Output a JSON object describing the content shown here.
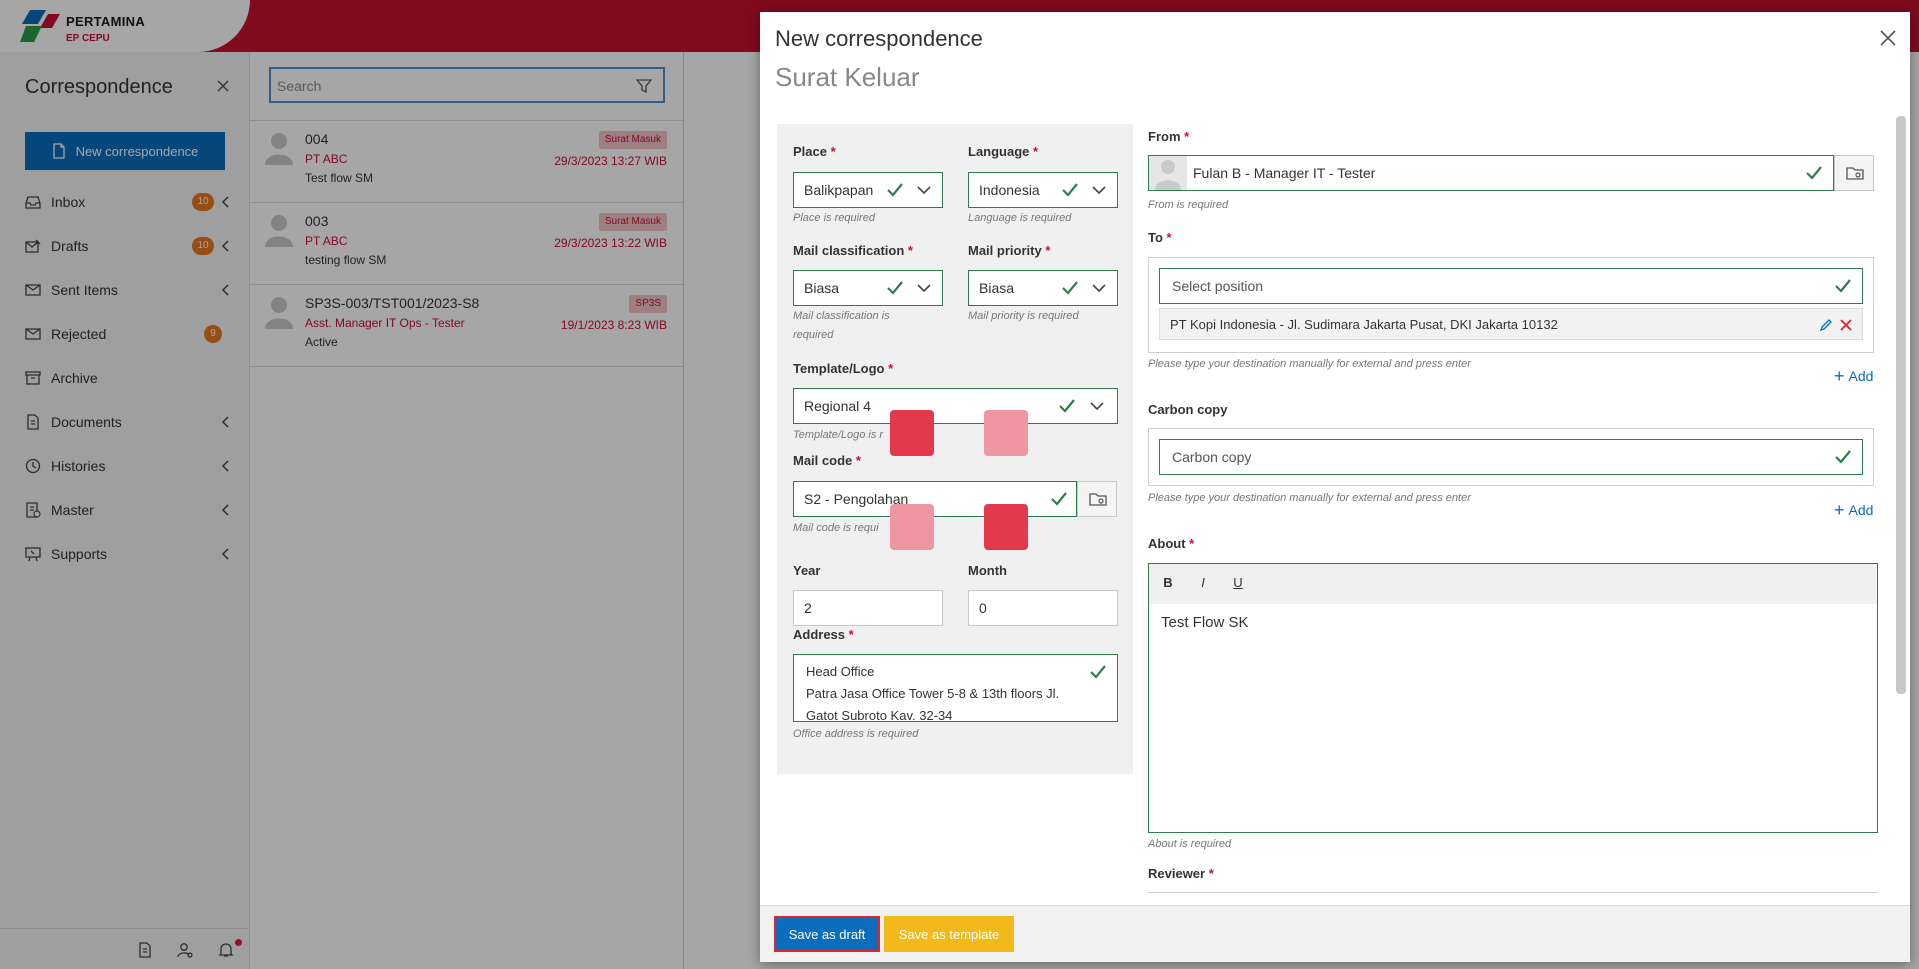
{
  "brand": {
    "name": "PERTAMINA",
    "sub": "EP CEPU"
  },
  "sidebar": {
    "title": "Correspondence",
    "new_button": "New correspondence",
    "items": [
      {
        "label": "Inbox",
        "icon": "inbox-icon",
        "badge": "10",
        "chevron": true
      },
      {
        "label": "Drafts",
        "icon": "drafts-icon",
        "badge": "10",
        "chevron": true
      },
      {
        "label": "Sent Items",
        "icon": "sent-icon",
        "badge": "",
        "chevron": true
      },
      {
        "label": "Rejected",
        "icon": "rejected-icon",
        "badge": "9",
        "chevron": false
      },
      {
        "label": "Archive",
        "icon": "archive-icon",
        "badge": "",
        "chevron": false
      },
      {
        "label": "Documents",
        "icon": "documents-icon",
        "badge": "",
        "chevron": true
      },
      {
        "label": "Histories",
        "icon": "history-icon",
        "badge": "",
        "chevron": true
      },
      {
        "label": "Master",
        "icon": "master-icon",
        "badge": "",
        "chevron": true
      },
      {
        "label": "Supports",
        "icon": "supports-icon",
        "badge": "",
        "chevron": true
      }
    ]
  },
  "list": {
    "search_placeholder": "Search",
    "rows": [
      {
        "number": "004",
        "sender": "PT ABC",
        "subject": "Test flow SM",
        "tag": "Surat Masuk",
        "date": "29/3/2023 13:27 WIB"
      },
      {
        "number": "003",
        "sender": "PT ABC",
        "subject": "testing flow SM",
        "tag": "Surat Masuk",
        "date": "29/3/2023 13:22 WIB"
      },
      {
        "number": "SP3S-003/TST001/2023-S8",
        "sender": "Asst. Manager IT Ops - Tester",
        "subject": "Active",
        "tag": "SP3S",
        "date": "19/1/2023 8:23 WIB"
      }
    ]
  },
  "modal": {
    "title": "New correspondence",
    "subtitle": "Surat Keluar",
    "place": {
      "label": "Place",
      "value": "Balikpapan",
      "hint": "Place is required"
    },
    "language": {
      "label": "Language",
      "value": "Indonesia",
      "hint": "Language is required"
    },
    "classification": {
      "label": "Mail classification",
      "value": "Biasa",
      "hint_line1": "Mail classification is",
      "hint_line2": "required"
    },
    "priority": {
      "label": "Mail priority",
      "value": "Biasa",
      "hint": "Mail priority is required"
    },
    "template": {
      "label": "Template/Logo",
      "value": "Regional 4",
      "hint": "Template/Logo is r"
    },
    "mail_code": {
      "label": "Mail code",
      "value": "S2 - Pengolahan",
      "hint": "Mail code is requi"
    },
    "year": {
      "label": "Year",
      "value": "2"
    },
    "month": {
      "label": "Month",
      "value": "0"
    },
    "address": {
      "label": "Address",
      "lines": [
        "Head Office",
        "Patra Jasa Office Tower 5-8 & 13th floors Jl.",
        "Gatot Subroto Kav. 32-34"
      ],
      "hint": "Office address is required"
    },
    "from": {
      "label": "From",
      "value": "Fulan B - Manager IT - Tester",
      "hint": "From is required"
    },
    "to": {
      "label": "To",
      "placeholder": "Select position",
      "destination": "PT Kopi Indonesia - Jl. Sudimara Jakarta Pusat, DKI Jakarta 10132",
      "hint": "Please type your destination manually for external and press enter",
      "add": "Add"
    },
    "cc": {
      "label": "Carbon copy",
      "placeholder": "Carbon copy",
      "hint": "Please type your destination manually for external and press enter",
      "add": "Add"
    },
    "about": {
      "label": "About",
      "content": "Test Flow SK",
      "hint": "About is required",
      "bold": "B",
      "italic": "I",
      "underline": "U"
    },
    "reviewer": {
      "label": "Reviewer"
    },
    "buttons": {
      "draft": "Save as draft",
      "template": "Save as template"
    }
  },
  "colors": {
    "brand_red": "#c8102e",
    "primary_blue": "#0a6ebd",
    "valid_green": "#2e7d4f",
    "badge_orange": "#e8781c",
    "warning_yellow": "#f1b91a"
  }
}
